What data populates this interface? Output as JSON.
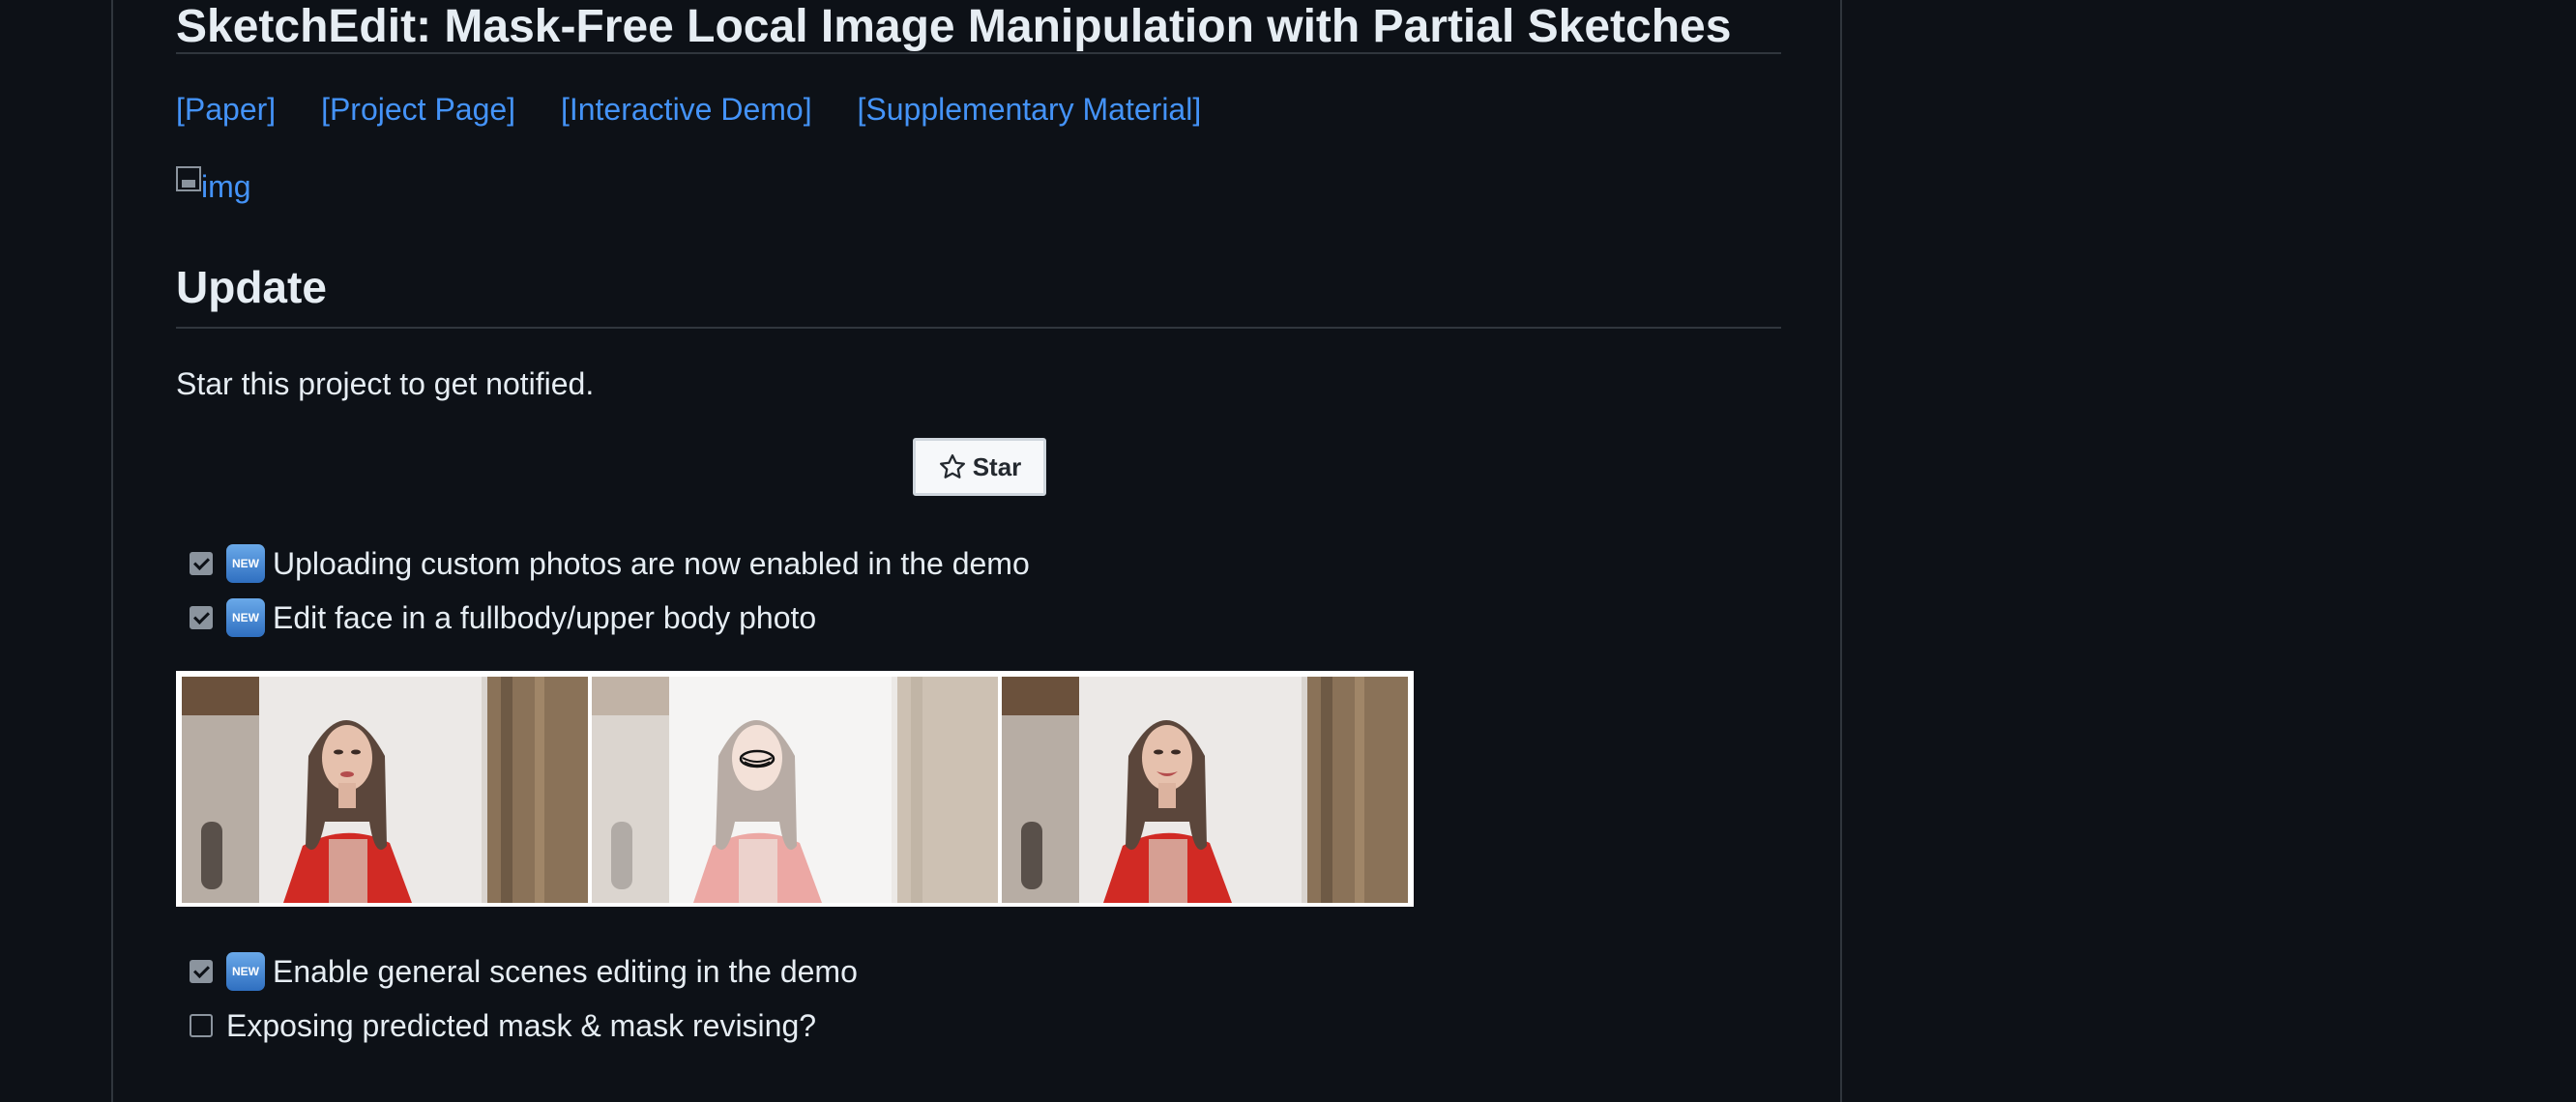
{
  "title": "SketchEdit: Mask-Free Local Image Manipulation with Partial Sketches",
  "links": [
    {
      "label": "[Paper]"
    },
    {
      "label": "[Project Page]"
    },
    {
      "label": "[Interactive Demo]"
    },
    {
      "label": "[Supplementary Material]"
    }
  ],
  "broken_image_alt": "img",
  "update_heading": "Update",
  "star_note": "Star this project to get notified.",
  "star_button": {
    "label": "Star"
  },
  "tasks_top": [
    {
      "badge": "NEW",
      "text": "Uploading custom photos are now enabled in the demo",
      "checked": true
    },
    {
      "badge": "NEW",
      "text": "Edit face in a fullbody/upper body photo",
      "checked": true
    }
  ],
  "tasks_bottom": [
    {
      "badge": "NEW",
      "text": "Enable general scenes editing in the demo",
      "checked": true
    },
    {
      "badge": "",
      "text": "Exposing predicted mask & mask revising?",
      "checked": false
    }
  ],
  "colors": {
    "background": "#0d1117",
    "text": "#e6edf3",
    "link": "#4493f8",
    "border": "#30363d"
  }
}
